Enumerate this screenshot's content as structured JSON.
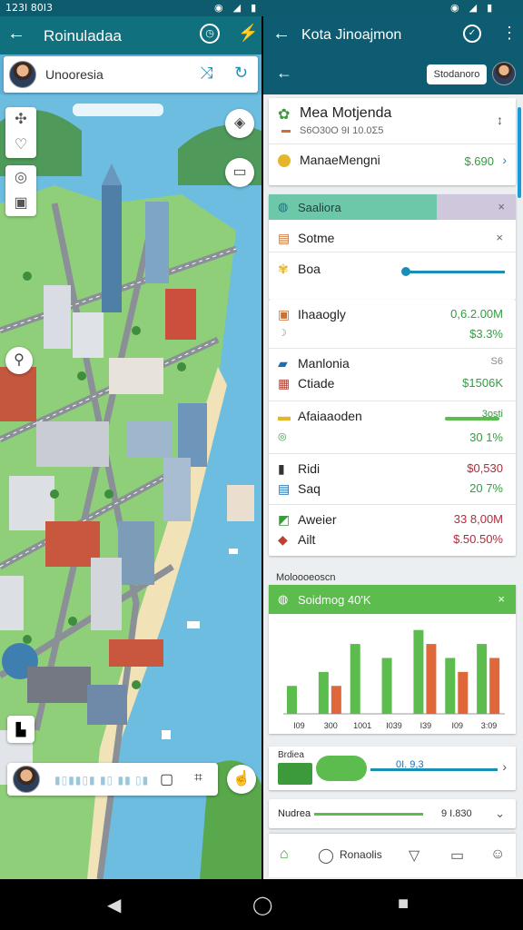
{
  "status": {
    "time": "123I 80I3"
  },
  "left": {
    "title": "Roinuladaa",
    "search_label": "Unooresia",
    "bottom_bars": "▮▯▮▮▯▮ ▮▯ ▮▮ ▯▮"
  },
  "right": {
    "title": "Kota Jinoajmon",
    "chip": "Stodanoro",
    "header_card": {
      "title": "Mea Motjenda",
      "subtitle": "S6O30O 9I 10.0Σ5",
      "row_label": "ManaeMengni",
      "row_value": "$.690"
    },
    "section_bar": "Saaliora",
    "list1": [
      {
        "label": "Sotme"
      },
      {
        "label": "Boa"
      }
    ],
    "stats": [
      {
        "label": "Ihaaogly",
        "value1": "0,6.2.00M",
        "value2": "$3.3%",
        "color1": "green",
        "color2": "green"
      },
      {
        "label": "Manlonia",
        "sub": "Ctiade",
        "value1": "S6",
        "value2": "$1506K",
        "color2": "green"
      },
      {
        "label": "Afaiaaoden",
        "value1": "3osti",
        "value2": "30 1%",
        "color1": "green",
        "color2": "green"
      },
      {
        "label": "Ridi",
        "sub": "Saq",
        "value1": "$0,530",
        "value2": "20 7%",
        "color1": "red",
        "color2": "green"
      },
      {
        "label": "Aweier",
        "sub": "Ailt",
        "value1": "33 8,00M",
        "value2": "$.50.50%",
        "color1": "red",
        "color2": "red"
      }
    ],
    "section_label": "Moloooeoscn",
    "chart_head": "Soidmog 40'K",
    "chart_data": {
      "type": "bar",
      "categories": [
        "I09",
        "300",
        "1001",
        "I039",
        "I39",
        "I09",
        "3:09"
      ],
      "series": [
        {
          "values": [
            2,
            3,
            5,
            4,
            6,
            4,
            5
          ],
          "color": "#5cbc4e"
        },
        {
          "values": [
            0,
            2,
            0,
            0,
            5,
            3,
            4
          ],
          "color": "#e0673a"
        }
      ]
    },
    "progress_title": "Brdiea",
    "progress_value": "0I. 9,3",
    "footer_label": "Nudrea",
    "footer_nums": "9  I.830",
    "nav_label": "Ronaolis"
  }
}
